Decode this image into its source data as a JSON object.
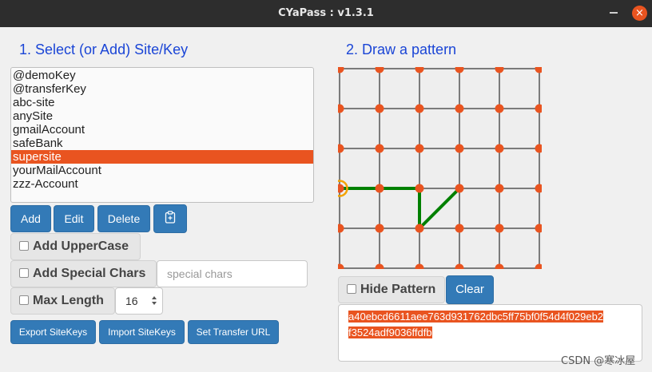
{
  "window": {
    "title": "CYaPass : v1.3.1",
    "close_glyph": "×"
  },
  "section1": {
    "heading": "1. Select (or Add) Site/Key",
    "sites": [
      "@demoKey",
      "@transferKey",
      "abc-site",
      "anySite",
      "gmailAccount",
      "safeBank",
      "supersite",
      "yourMailAccount",
      "zzz-Account"
    ],
    "selected_site": "supersite",
    "buttons": {
      "add": "Add",
      "edit": "Edit",
      "delete": "Delete",
      "paste_icon": "clipboard-icon"
    },
    "options": {
      "uppercase": {
        "label": "Add UpperCase",
        "checked": false
      },
      "special": {
        "label": "Add Special Chars",
        "checked": false,
        "placeholder": "special chars"
      },
      "maxlen": {
        "label": "Max Length",
        "checked": false,
        "value": "16"
      }
    },
    "actions": {
      "export": "Export SiteKeys",
      "import": "Import SiteKeys",
      "transfer": "Set Transfer URL"
    }
  },
  "section2": {
    "heading": "2. Draw a pattern",
    "grid_size": 6,
    "pattern_points": [
      [
        0,
        3
      ],
      [
        1,
        3
      ],
      [
        2,
        3
      ],
      [
        2,
        4
      ],
      [
        3,
        3
      ]
    ],
    "hide_pattern": {
      "label": "Hide Pattern",
      "checked": false
    },
    "clear": "Clear",
    "password_line1": "a40ebcd6611aee763d931762dbc5ff75bf0f54d4f029eb2",
    "password_line2": "f3524adf9036ffdfb"
  },
  "colors": {
    "accent": "#e95420",
    "button": "#337ab7",
    "heading": "#1a45d6",
    "pattern_line": "#008000",
    "start_ring": "#f4a300"
  },
  "watermark": "CSDN @寒冰屋"
}
